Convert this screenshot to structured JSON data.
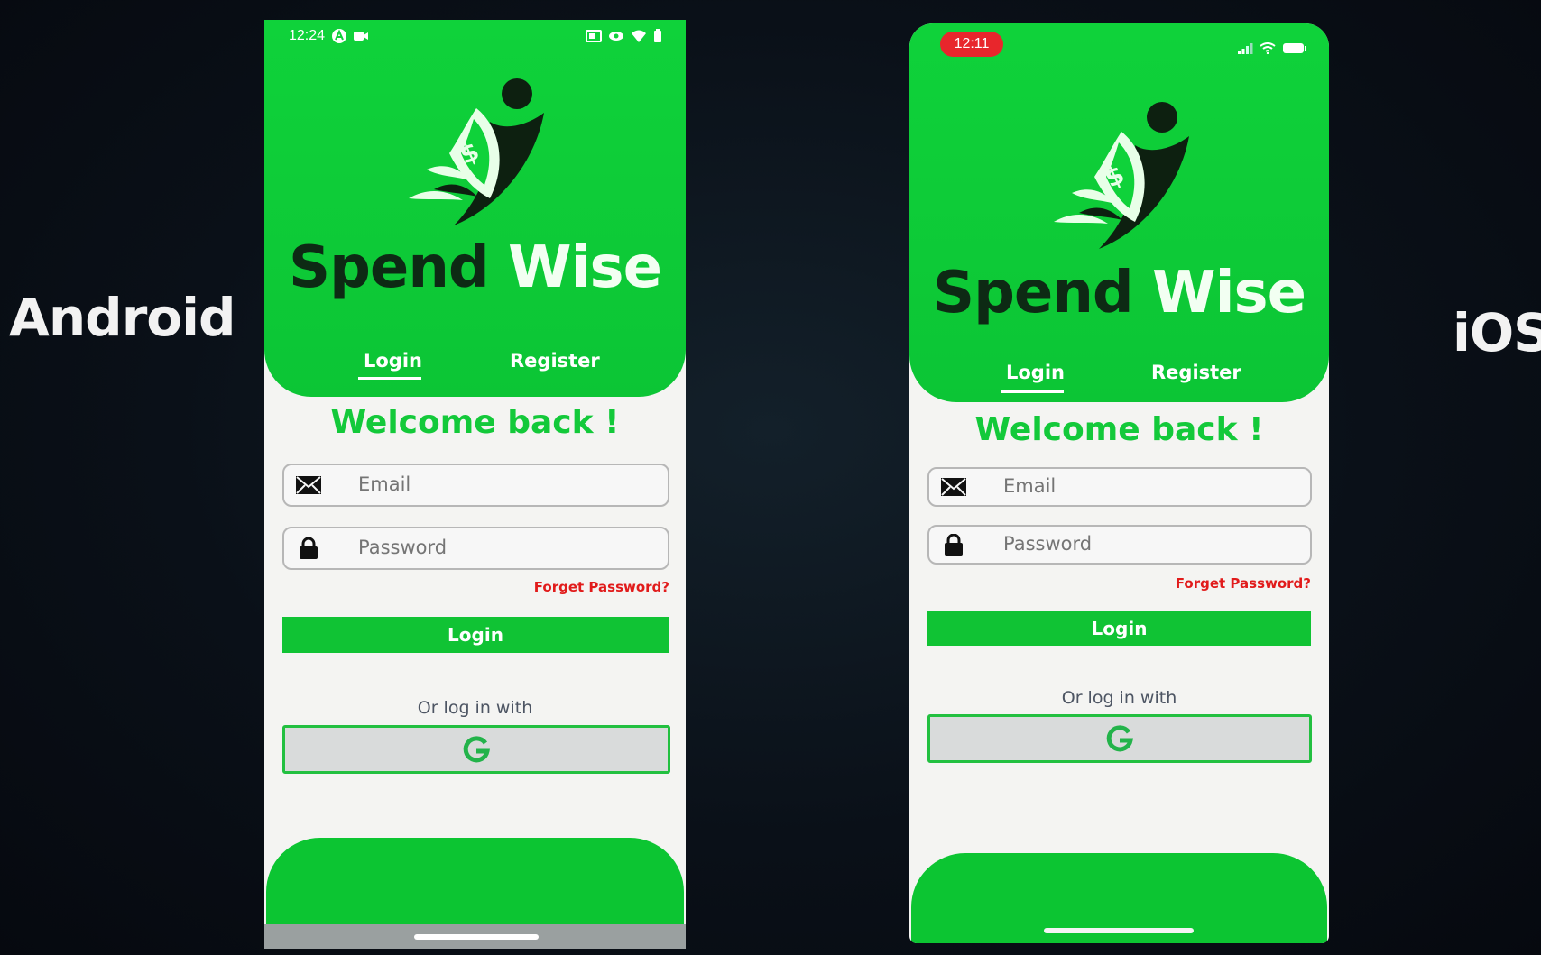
{
  "labels": {
    "android": "Android",
    "ios": "iOS"
  },
  "android": {
    "status_time": "12:24",
    "brand": {
      "part1": "Spend",
      "part2": "Wise"
    },
    "tabs": {
      "login": "Login",
      "register": "Register"
    },
    "welcome": "Welcome back !",
    "email_placeholder": "Email",
    "password_placeholder": "Password",
    "forgot": "Forget Password?",
    "login_button": "Login",
    "or_text": "Or log in with",
    "google_letter": "G"
  },
  "ios": {
    "status_time": "12:11",
    "brand": {
      "part1": "Spend",
      "part2": "Wise"
    },
    "tabs": {
      "login": "Login",
      "register": "Register"
    },
    "welcome": "Welcome back !",
    "email_placeholder": "Email",
    "password_placeholder": "Password",
    "forgot": "Forget Password?",
    "login_button": "Login",
    "or_text": "Or log in with",
    "google_letter": "G"
  },
  "colors": {
    "brand_green": "#0fd23a",
    "welcome_green": "#13c93a",
    "button_green": "#10c334",
    "forgot_red": "#e11b1b",
    "ios_time_pill": "#e8262c"
  },
  "icons": [
    "logo-icon",
    "email-icon",
    "lock-icon",
    "google-icon",
    "wifi-icon",
    "battery-icon",
    "signal-icon"
  ]
}
